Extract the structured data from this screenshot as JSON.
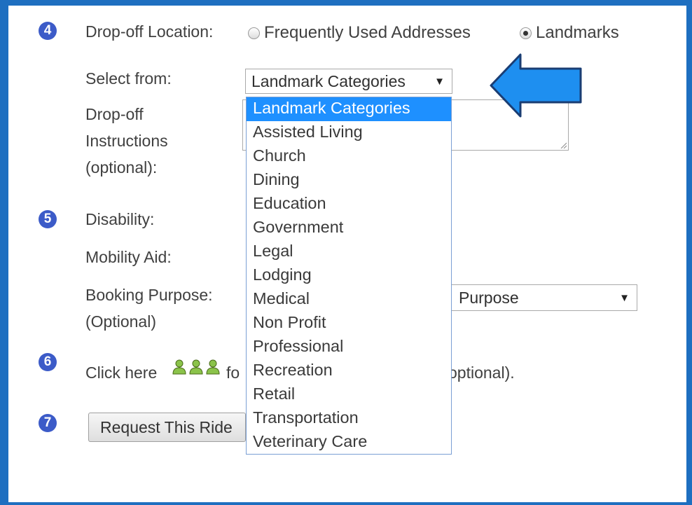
{
  "steps": {
    "four": "4",
    "five": "5",
    "six": "6",
    "seven": "7"
  },
  "dropoff": {
    "label": "Drop-off Location:",
    "radio_frequent": "Frequently Used Addresses",
    "radio_landmarks": "Landmarks",
    "selected_radio": "Landmarks",
    "select_from_label": "Select from:",
    "select_value": "Landmark Categories",
    "instructions_label_1": "Drop-off",
    "instructions_label_2": "Instructions",
    "instructions_label_3": "(optional):"
  },
  "dropdown": {
    "options": [
      "Landmark Categories",
      "Assisted Living",
      "Church",
      "Dining",
      "Education",
      "Government",
      "Legal",
      "Lodging",
      "Medical",
      "Non Profit",
      "Professional",
      "Recreation",
      "Retail",
      "Transportation",
      "Veterinary Care"
    ],
    "highlighted": "Landmark Categories"
  },
  "section5": {
    "disability_label": "Disability:",
    "mobility_label": "Mobility Aid:",
    "purpose_label_1": "Booking Purpose:",
    "purpose_label_2": "(Optional)",
    "purpose_select_value": "Purpose"
  },
  "section6": {
    "click_here": "Click here",
    "text_after_icon": "fo",
    "text_tail": "optional)."
  },
  "section7": {
    "button_label": "Request This Ride"
  },
  "colors": {
    "frame": "#1e6fc0",
    "highlight": "#1e90ff",
    "arrow": "#1e8ff0",
    "badge": "#3c5bc8"
  },
  "icons": {
    "callout": "left-arrow-icon",
    "passengers": "people-icon"
  }
}
